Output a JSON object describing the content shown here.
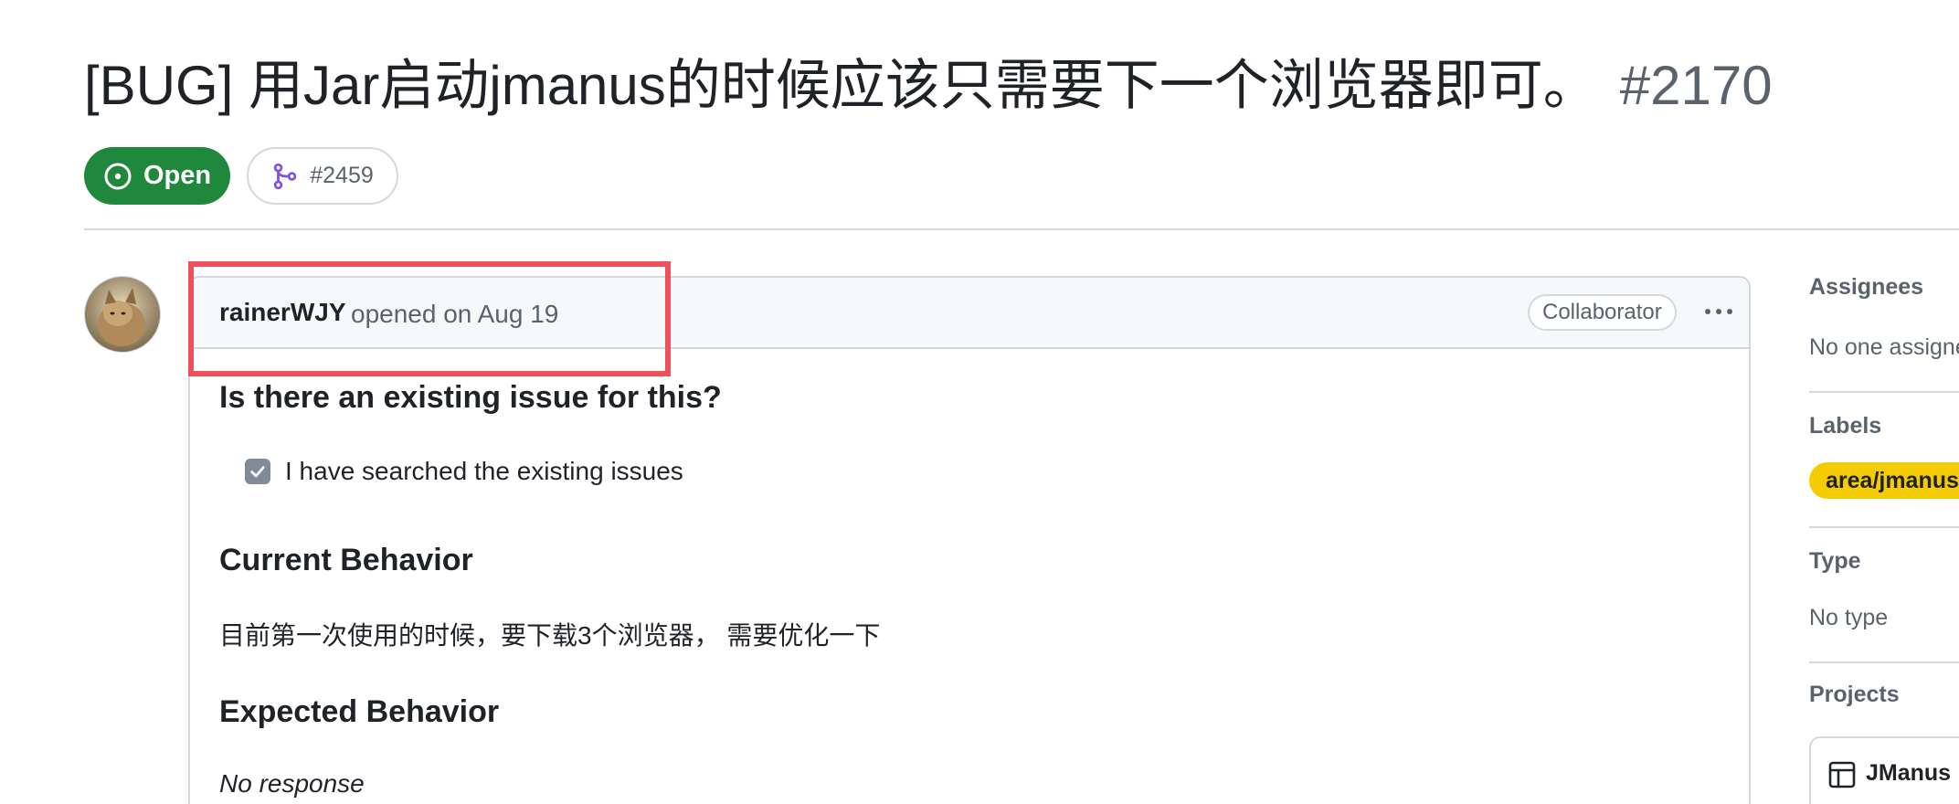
{
  "issue": {
    "title": "[BUG] 用Jar启动jmanus的时候应该只需要下一个浏览器即可。",
    "number": "#2170",
    "state": "Open",
    "linked_pr": "#2459"
  },
  "comment": {
    "author": "rainerWJY",
    "opened": "opened on Aug 19",
    "role": "Collaborator",
    "sections": {
      "existing_heading": "Is there an existing issue for this?",
      "task_item": "I have searched the existing issues",
      "task_checked": true,
      "current_heading": "Current Behavior",
      "current_text": "目前第一次使用的时候，要下载3个浏览器， 需要优化一下",
      "expected_heading": "Expected Behavior",
      "expected_text": "No response"
    }
  },
  "sidebar": {
    "assignees_heading": "Assignees",
    "assignees_value": "No one assigne",
    "labels_heading": "Labels",
    "label": "area/jmanus",
    "type_heading": "Type",
    "type_value": "No type",
    "projects_heading": "Projects",
    "project_name": "JManus"
  },
  "colors": {
    "open_green": "#1f883d",
    "label_yellow": "#f5cc04",
    "highlight_red": "#f0505a",
    "muted": "#59636e",
    "border": "#d1d9e0"
  },
  "icons": {
    "state": "issue-opened-icon",
    "pr": "git-merge-icon",
    "checkbox": "check-icon",
    "more": "kebab-horizontal-icon",
    "project": "table-icon"
  }
}
